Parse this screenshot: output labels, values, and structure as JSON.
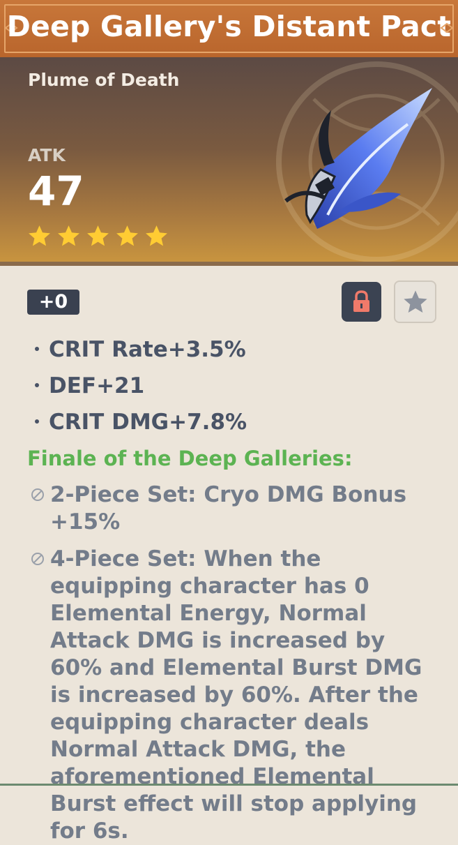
{
  "artifact": {
    "name": "Deep Gallery's Distant Pact",
    "slot": "Plume of Death",
    "main_stat": {
      "label": "ATK",
      "value": "47"
    },
    "rarity": 5,
    "level": "+0"
  },
  "substats": [
    "CRIT Rate+3.5%",
    "DEF+21",
    "CRIT DMG+7.8%"
  ],
  "set": {
    "name": "Finale of the Deep Galleries:",
    "two_piece": "2-Piece Set: Cryo DMG Bonus +15%",
    "four_piece": "4-Piece Set: When the equipping character has 0 Elemental Energy, Normal Attack DMG is increased by 60% and Elemental Burst DMG is increased by 60%. After the equipping character deals Normal Attack DMG, the aforementioned Elemental Burst effect will stop applying for 6s."
  },
  "icons": {
    "lock": "lock-icon",
    "favorite": "star-outline-icon",
    "rarity": "star-icon"
  },
  "colors": {
    "title_bar": "#b9652c",
    "set_name": "#5cb352",
    "star": "#ffcc33",
    "lock": "#f07a6a"
  }
}
